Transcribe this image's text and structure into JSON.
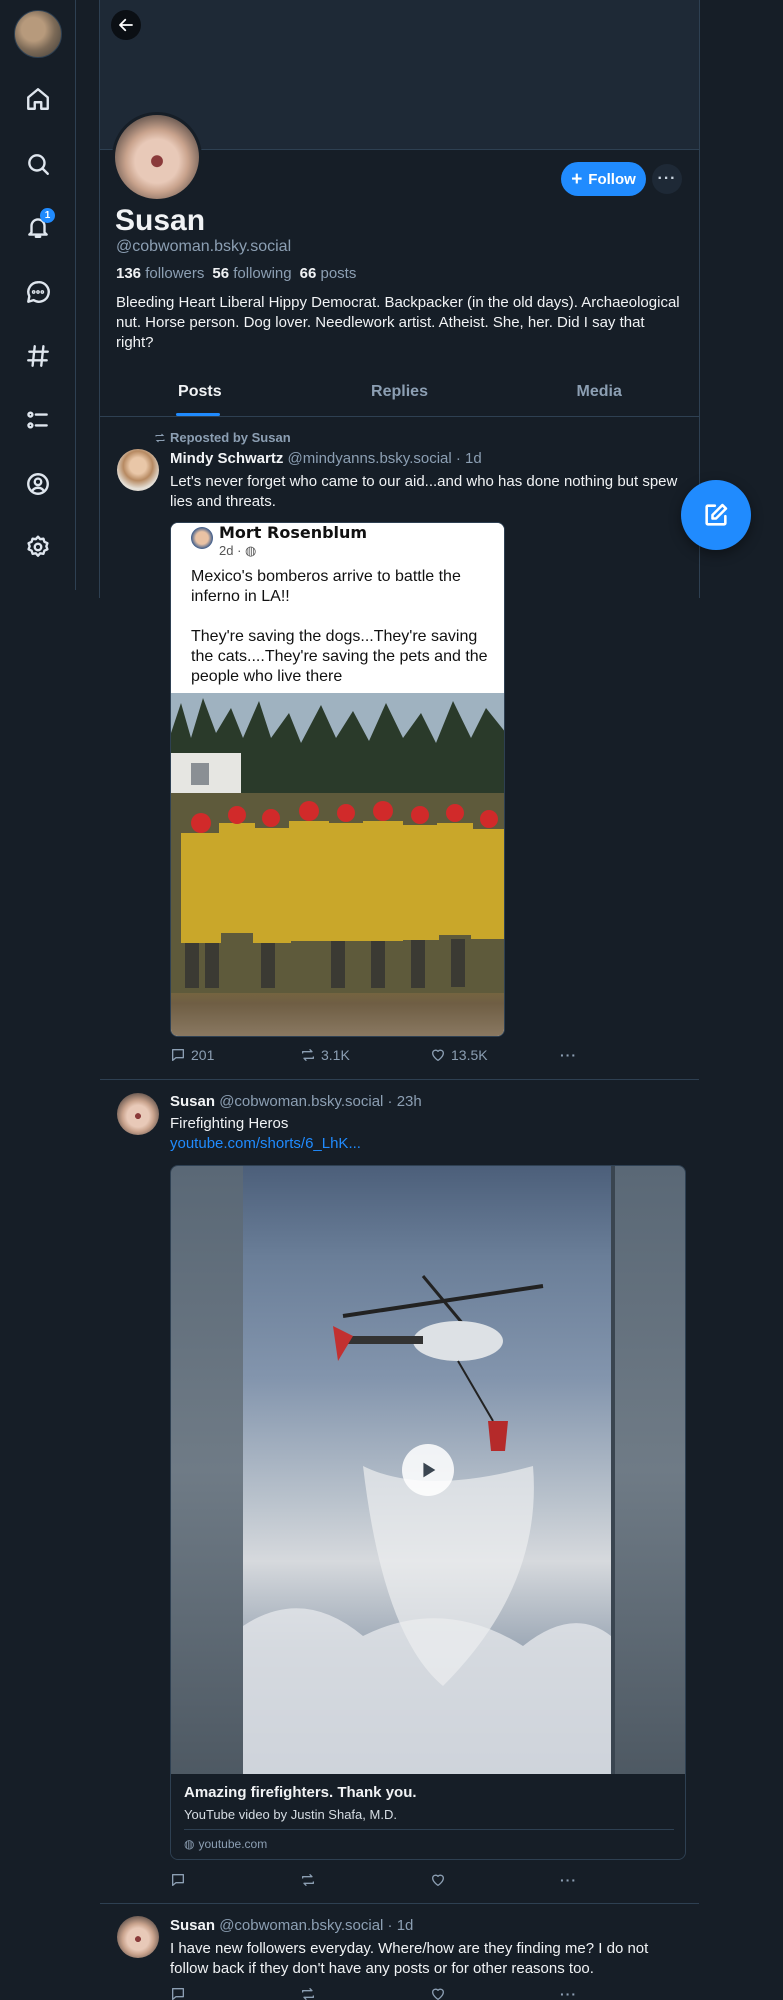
{
  "nav": {
    "notification_count": "1",
    "items": [
      "home",
      "search",
      "notifications",
      "chat",
      "feeds",
      "lists",
      "profile",
      "settings"
    ]
  },
  "profile": {
    "display_name": "Susan",
    "handle": "@cobwoman.bsky.social",
    "followers_count": "136",
    "followers_label": "followers",
    "following_count": "56",
    "following_label": "following",
    "posts_count": "66",
    "posts_label": "posts",
    "bio": "Bleeding Heart Liberal Hippy Democrat. Backpacker (in the old days). Archaeological nut. Horse person. Dog lover. Needlework artist. Atheist. She, her. Did I say that right?",
    "follow_label": "Follow",
    "more_label": "···"
  },
  "tabs": [
    "Posts",
    "Replies",
    "Media"
  ],
  "posts": [
    {
      "repost_label": "Reposted by Susan",
      "author": "Mindy Schwartz",
      "handle": "@mindyanns.bsky.social",
      "time": "· 1d",
      "text": "Let's never forget who came to our aid...and who has done nothing but spew lies and threats.",
      "embed": {
        "name": "Mort Rosenblum",
        "time": "2d ·",
        "text_1": "Mexico's bomberos arrive to battle the inferno in LA!!",
        "text_2": "They're saving the dogs...They're saving the cats....They're saving the pets and the people who live there"
      },
      "replies": "201",
      "reposts": "3.1K",
      "likes": "13.5K"
    },
    {
      "author": "Susan",
      "handle": "@cobwoman.bsky.social",
      "time": "· 23h",
      "text": "Firefighting Heros",
      "link": "youtube.com/shorts/6_LhK...",
      "card": {
        "title": "Amazing firefighters. Thank you.",
        "description": "YouTube video by Justin Shafa, M.D.",
        "domain": "youtube.com"
      }
    },
    {
      "author": "Susan",
      "handle": "@cobwoman.bsky.social",
      "time": "· 1d",
      "text": "I have new followers everyday. Where/how are they finding me? I do not follow back if they don't have any posts or for other reasons too."
    }
  ],
  "colors": {
    "accent": "#208bfe",
    "background": "#161e27",
    "muted": "#8c9fb3",
    "border": "#2e4052"
  }
}
